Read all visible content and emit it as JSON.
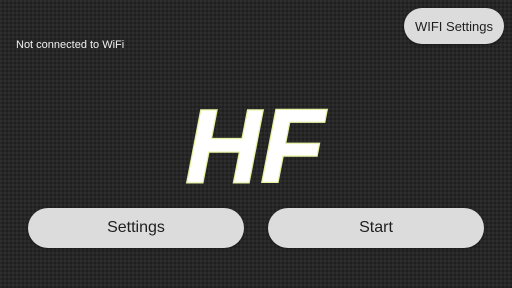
{
  "status": {
    "wifi_text": "Not connected to WiFi"
  },
  "toolbar": {
    "wifi_settings_label": "WIFI Settings"
  },
  "logo": {
    "text": "HF",
    "fill_color": "#ffffff",
    "outline_color": "#e6f0a0"
  },
  "actions": {
    "settings_label": "Settings",
    "start_label": "Start"
  },
  "colors": {
    "background": "#262626",
    "button_bg": "#dcdcdc",
    "button_text": "#1e1e1e"
  }
}
